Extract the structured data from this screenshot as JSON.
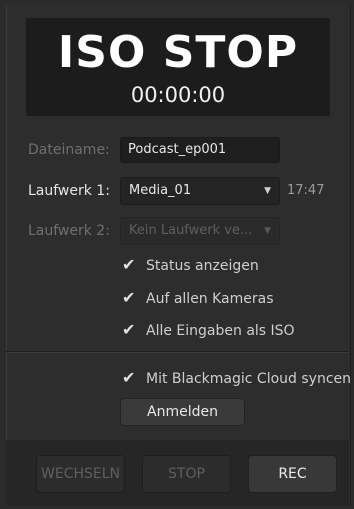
{
  "display": {
    "title": "ISO STOP",
    "timecode": "00:00:00"
  },
  "form": {
    "filename_label": "Dateiname:",
    "filename_value": "Podcast_ep001",
    "drive1_label": "Laufwerk 1:",
    "drive1_value": "Media_01",
    "drive1_time": "17:47",
    "drive2_label": "Laufwerk 2:",
    "drive2_value": "Kein Laufwerk ve..."
  },
  "options": [
    {
      "label": "Status anzeigen",
      "checked": true
    },
    {
      "label": "Auf allen Kameras",
      "checked": true
    },
    {
      "label": "Alle Eingaben als ISO",
      "checked": true
    }
  ],
  "cloud": {
    "sync_label": "Mit Blackmagic Cloud syncen",
    "checked": true,
    "login_label": "Anmelden"
  },
  "buttons": {
    "switch": "WECHSELN",
    "stop": "STOP",
    "rec": "REC"
  },
  "icons": {
    "check": "checkmark-icon",
    "dropdown": "chevron-down-icon"
  }
}
